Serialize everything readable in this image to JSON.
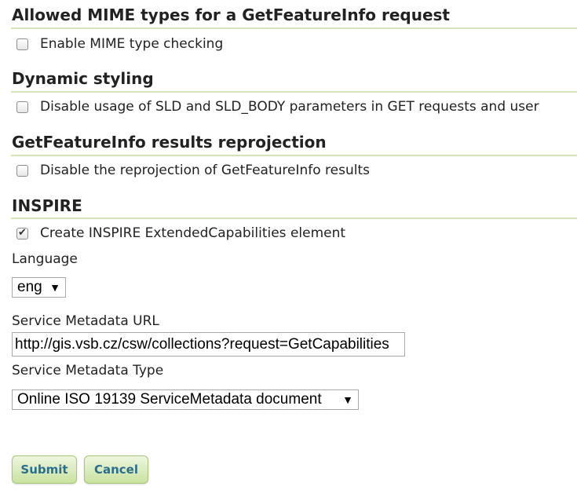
{
  "mime_section": {
    "title": "Allowed MIME types for a GetFeatureInfo request",
    "enable_mime_checking": {
      "label": "Enable MIME type checking",
      "checked": false
    }
  },
  "dynamic_styling": {
    "title": "Dynamic styling",
    "disable_sld": {
      "label": "Disable usage of SLD and SLD_BODY parameters in GET requests and user",
      "checked": false
    }
  },
  "reprojection": {
    "title": "GetFeatureInfo results reprojection",
    "disable_reprojection": {
      "label": "Disable the reprojection of GetFeatureInfo results",
      "checked": false
    }
  },
  "inspire": {
    "title": "INSPIRE",
    "create_extended_capabilities": {
      "label": "Create INSPIRE ExtendedCapabilities element",
      "checked": true,
      "check_glyph": "✔"
    },
    "language": {
      "label": "Language",
      "selected": "eng",
      "arrow": "▼"
    },
    "service_metadata_url": {
      "label": "Service Metadata URL",
      "value": "http://gis.vsb.cz/csw/collections?request=GetCapabilities"
    },
    "service_metadata_type": {
      "label": "Service Metadata Type",
      "selected": "Online ISO 19139 ServiceMetadata document",
      "arrow": "▼"
    }
  },
  "actions": {
    "submit_label": "Submit",
    "cancel_label": "Cancel"
  },
  "colors": {
    "section_rule": "#d3e4b7",
    "button_gradient_top": "#eef6e0",
    "button_gradient_bottom": "#c9e29f",
    "button_text": "#2a6f8f"
  }
}
